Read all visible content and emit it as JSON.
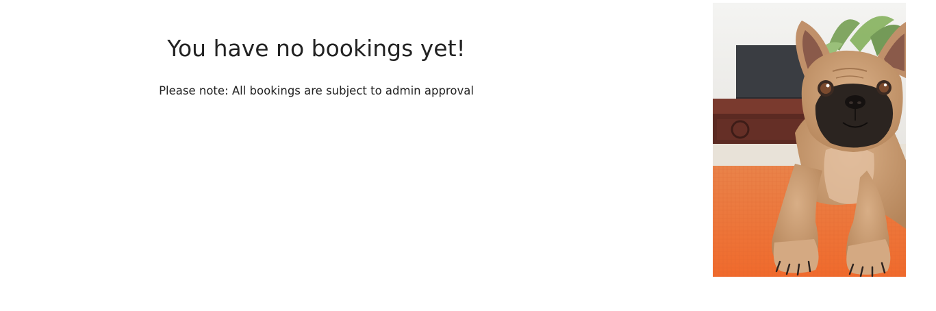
{
  "empty_state": {
    "title": "You have no bookings yet!",
    "note": "Please note: All bookings are subject to admin approval"
  },
  "photo": {
    "subject": "french-bulldog-photo",
    "colors": {
      "floor": "#f07a3a",
      "dog_fur": "#c99a6e",
      "dog_mask": "#2b2420",
      "wall": "#eeeeee"
    }
  }
}
